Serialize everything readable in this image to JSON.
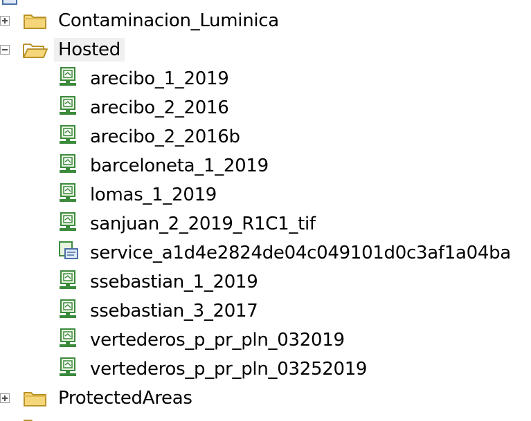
{
  "tree": {
    "folder_contaminacion": {
      "label": "Contaminacion_Luminica",
      "expanded": false
    },
    "folder_hosted": {
      "label": "Hosted",
      "expanded": true,
      "items": [
        {
          "label": "arecibo_1_2019",
          "icon": "image-service-icon"
        },
        {
          "label": "arecibo_2_2016",
          "icon": "image-service-icon"
        },
        {
          "label": "arecibo_2_2016b",
          "icon": "image-service-icon"
        },
        {
          "label": "barceloneta_1_2019",
          "icon": "image-service-icon"
        },
        {
          "label": "lomas_1_2019",
          "icon": "image-service-icon"
        },
        {
          "label": "sanjuan_2_2019_R1C1_tif",
          "icon": "image-service-icon"
        },
        {
          "label": "service_a1d4e2824de04c049101d0c3af1a04ba",
          "icon": "map-service-icon"
        },
        {
          "label": "ssebastian_1_2019",
          "icon": "image-service-icon"
        },
        {
          "label": "ssebastian_3_2017",
          "icon": "image-service-icon"
        },
        {
          "label": "vertederos_p_pr_pln_032019",
          "icon": "image-service-icon"
        },
        {
          "label": "vertederos_p_pr_pln_03252019",
          "icon": "image-service-icon"
        }
      ]
    },
    "folder_protected": {
      "label": "ProtectedAreas",
      "expanded": false
    }
  },
  "colors": {
    "folder_fill": "#f5d67a",
    "folder_stroke": "#b8922a",
    "service_green": "#3c8a3c",
    "service_fill": "#e8f3e0"
  }
}
